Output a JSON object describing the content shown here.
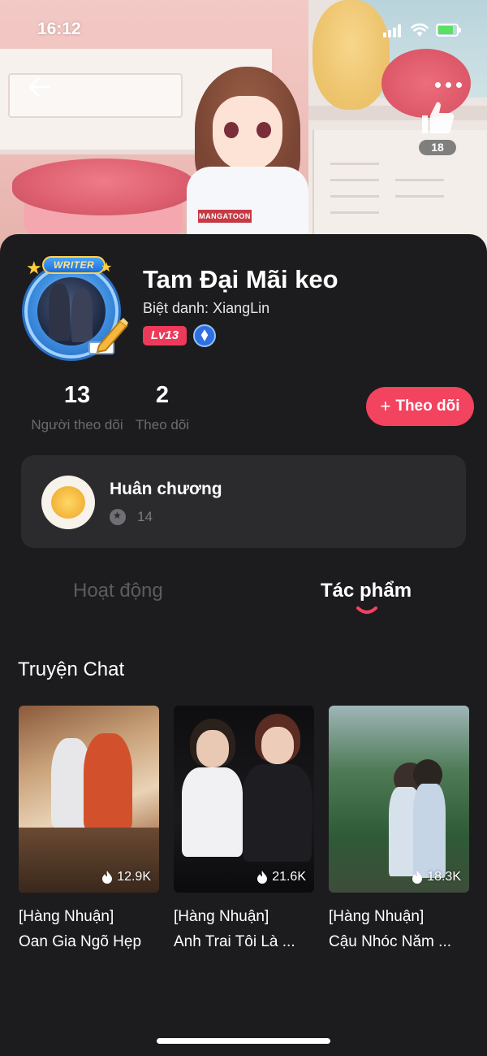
{
  "status_bar": {
    "time": "16:12"
  },
  "header": {
    "like_count": "18",
    "shirt_text": "MANGATOON"
  },
  "profile": {
    "writer_tag": "WRITER",
    "name": "Tam Đại Mãi keo",
    "nickname": "Biệt danh: XiangLin",
    "level": "Lv13",
    "followers_count": "13",
    "followers_label": "Người theo dõi",
    "following_count": "2",
    "following_label": "Theo dõi",
    "follow_button": "Theo dõi"
  },
  "medals": {
    "title": "Huân chương",
    "count": "14"
  },
  "tabs": [
    {
      "label": "Hoạt động",
      "active": false
    },
    {
      "label": "Tác phẩm",
      "active": true
    }
  ],
  "section": {
    "title": "Truyện Chat"
  },
  "works": [
    {
      "line1": "[Hàng Nhuận]",
      "line2": "Oan Gia Ngõ Hẹp",
      "views": "12.9K"
    },
    {
      "line1": "[Hàng Nhuận]",
      "line2": "Anh Trai Tôi Là ...",
      "views": "21.6K"
    },
    {
      "line1": "[Hàng Nhuận]",
      "line2": "Cậu Nhóc Năm ...",
      "views": "18.3K"
    }
  ],
  "colors": {
    "accent": "#f2435f",
    "background": "#1c1c1e",
    "card": "#2b2b2e"
  },
  "icons": [
    "back-arrow-icon",
    "more-options-icon",
    "thumbs-up-icon",
    "plus-icon",
    "fire-icon",
    "star-icon",
    "medal-icon"
  ]
}
